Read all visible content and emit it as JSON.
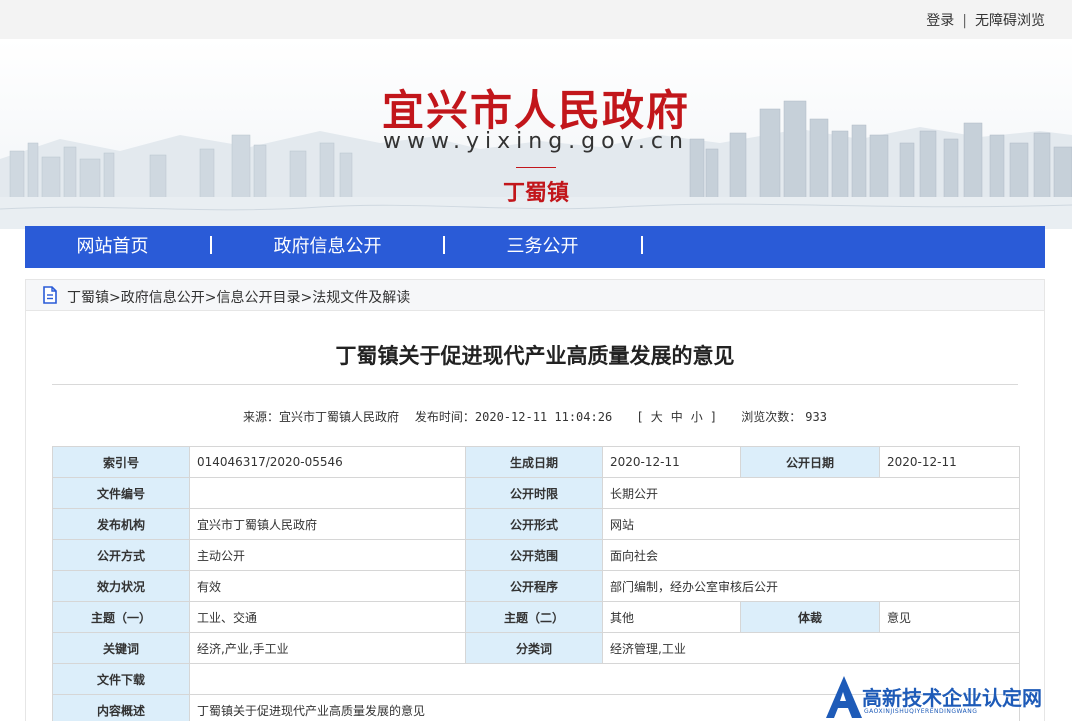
{
  "topbar": {
    "login": "登录",
    "separator": "|",
    "accessibility": "无障碍浏览"
  },
  "banner": {
    "title": "宜兴市人民政府",
    "url": "www.yixing.gov.cn",
    "town": "丁蜀镇"
  },
  "nav": {
    "items": [
      "网站首页",
      "政府信息公开",
      "三务公开"
    ]
  },
  "breadcrumb": {
    "items": [
      "丁蜀镇",
      "政府信息公开",
      "信息公开目录",
      "法规文件及解读"
    ],
    "separator": ">"
  },
  "article": {
    "title": "丁蜀镇关于促进现代产业高质量发展的意见",
    "source_label": "来源：",
    "source": "宜兴市丁蜀镇人民政府",
    "publish_label": "发布时间：",
    "publish_time": "2020-12-11 11:04:26",
    "font_size": {
      "open": "[",
      "large": "大",
      "medium": "中",
      "small": "小",
      "close": "]"
    },
    "views_label": "浏览次数：",
    "views": "933"
  },
  "info_table": {
    "index_no_label": "索引号",
    "index_no": "014046317/2020-05546",
    "gen_date_label": "生成日期",
    "gen_date": "2020-12-11",
    "pub_date_label": "公开日期",
    "pub_date": "2020-12-11",
    "doc_no_label": "文件编号",
    "doc_no": "",
    "pub_period_label": "公开时限",
    "pub_period": "长期公开",
    "issuer_label": "发布机构",
    "issuer": "宜兴市丁蜀镇人民政府",
    "pub_form_label": "公开形式",
    "pub_form": "网站",
    "pub_method_label": "公开方式",
    "pub_method": "主动公开",
    "pub_scope_label": "公开范围",
    "pub_scope": "面向社会",
    "validity_label": "效力状况",
    "validity": "有效",
    "pub_procedure_label": "公开程序",
    "pub_procedure": "部门编制，经办公室审核后公开",
    "topic1_label": "主题（一）",
    "topic1": "工业、交通",
    "topic2_label": "主题（二）",
    "topic2": "其他",
    "genre_label": "体裁",
    "genre": "意见",
    "keywords_label": "关键词",
    "keywords": "经济,产业,手工业",
    "category_label": "分类词",
    "category": "经济管理,工业",
    "download_label": "文件下载",
    "download": "",
    "summary_label": "内容概述",
    "summary": "丁蜀镇关于促进现代产业高质量发展的意见"
  },
  "watermark": {
    "text": "高新技术企业认定网",
    "sub": "GAOXINJISHUQIYERENDINGWANG",
    "logo_letter": "A"
  },
  "colors": {
    "brand_red": "#c2161b",
    "nav_blue": "#2a5bd7",
    "label_bg": "#dceefa",
    "watermark_blue": "#1e5bb8"
  }
}
